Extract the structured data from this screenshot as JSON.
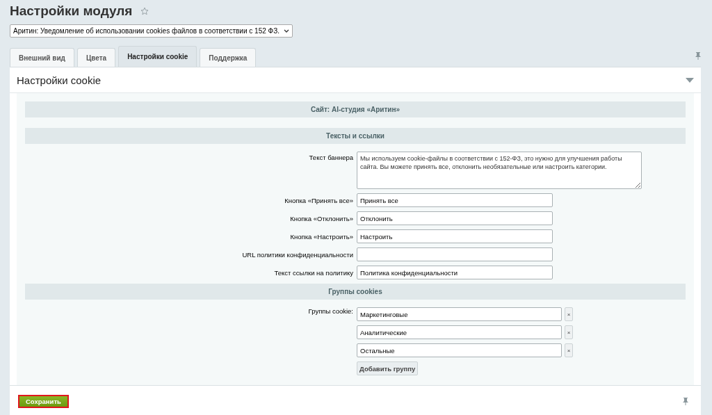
{
  "page_title": "Настройки модуля",
  "module_select": {
    "value": "Аритин: Уведомление об использовании cookies файлов в соответствии с 152 ФЗ."
  },
  "tabs": [
    {
      "label": "Внешний вид",
      "selected": false
    },
    {
      "label": "Цвета",
      "selected": false
    },
    {
      "label": "Настройки cookie",
      "selected": true
    },
    {
      "label": "Поддержка",
      "selected": false
    }
  ],
  "panel": {
    "title": "Настройки cookie",
    "site_heading": "Сайт: AI-студия «Аритин»",
    "sections": [
      {
        "heading": "Тексты и ссылки",
        "fields": [
          {
            "kind": "textarea",
            "label": "Текст баннера",
            "value": "Мы используем cookie-файлы в соответствии с 152-ФЗ, это нужно для улучшения работы сайта. Вы можете принять все, отклонить необязательные или настроить категории."
          },
          {
            "kind": "input",
            "label": "Кнопка «Принять все»",
            "value": "Принять все"
          },
          {
            "kind": "input",
            "label": "Кнопка «Отклонить»",
            "value": "Отклонить"
          },
          {
            "kind": "input",
            "label": "Кнопка «Настроить»",
            "value": "Настроить"
          },
          {
            "kind": "input",
            "label": "URL политики конфиденциальности"
          },
          {
            "kind": "input",
            "label": "Текст ссылки на политику",
            "value": "Политика конфиденциальности"
          }
        ]
      },
      {
        "heading": "Группы cookies",
        "groups_label": "Группы cookie:",
        "groups": [
          {
            "value": "Маркетинговые",
            "remove": "×"
          },
          {
            "value": "Аналитические",
            "remove": "×"
          },
          {
            "value": "Остальные",
            "remove": "×"
          }
        ],
        "add_button": "Добавить группу"
      }
    ]
  },
  "footer": {
    "save_button": "Сохранить",
    "highlighted": true
  }
}
